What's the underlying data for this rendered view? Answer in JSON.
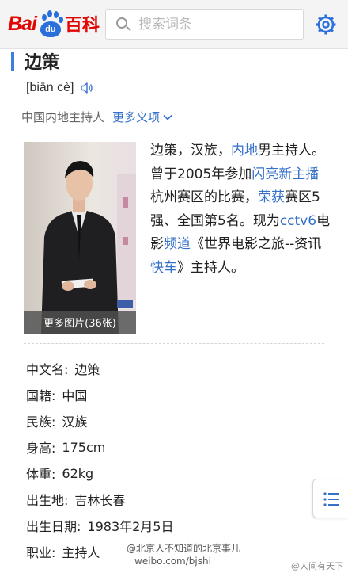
{
  "header": {
    "logo_text_left": "Bai",
    "logo_paw_text": "du",
    "logo_text_right": "百科",
    "search_placeholder": "搜索词条"
  },
  "entry": {
    "title": "边策",
    "pinyin": "[biān cè]",
    "subtitle": "中国内地主持人",
    "more_senses": "更多义项"
  },
  "photo": {
    "caption": "更多图片(36张)"
  },
  "summary": [
    {
      "text": "边策，汉族，",
      "link": false
    },
    {
      "text": "内地",
      "link": true
    },
    {
      "text": "男主持人。曾于2005年参加",
      "link": false
    },
    {
      "text": "闪亮新主播",
      "link": true
    },
    {
      "text": "杭州赛区的比赛，",
      "link": false
    },
    {
      "text": "荣获",
      "link": true
    },
    {
      "text": "赛区5强、全国第5名。现为",
      "link": false
    },
    {
      "text": "cctv6",
      "link": true
    },
    {
      "text": "电影",
      "link": false
    },
    {
      "text": "频道",
      "link": true
    },
    {
      "text": "《世界电影之旅--资讯",
      "link": false
    },
    {
      "text": "快车",
      "link": true
    },
    {
      "text": "》主持人。",
      "link": false
    }
  ],
  "info": [
    {
      "label": "中文名:",
      "value": "边策"
    },
    {
      "label": "国籍:",
      "value": "中国"
    },
    {
      "label": "民族:",
      "value": "汉族"
    },
    {
      "label": "身高:",
      "value": "175cm"
    },
    {
      "label": "体重:",
      "value": "62kg"
    },
    {
      "label": "出生地:",
      "value": "吉林长春"
    },
    {
      "label": "出生日期:",
      "value": "1983年2月5日"
    },
    {
      "label": "职业:",
      "value": "主持人"
    }
  ],
  "watermark": {
    "line1": "@北京人不知道的北京事儿",
    "line2": "weibo.com/bjshi",
    "right": "@人间有天下"
  },
  "colors": {
    "brand_red": "#e10601",
    "brand_blue": "#2b6fdb",
    "link_blue": "#3570c9",
    "accent_bar": "#3f7fde"
  }
}
